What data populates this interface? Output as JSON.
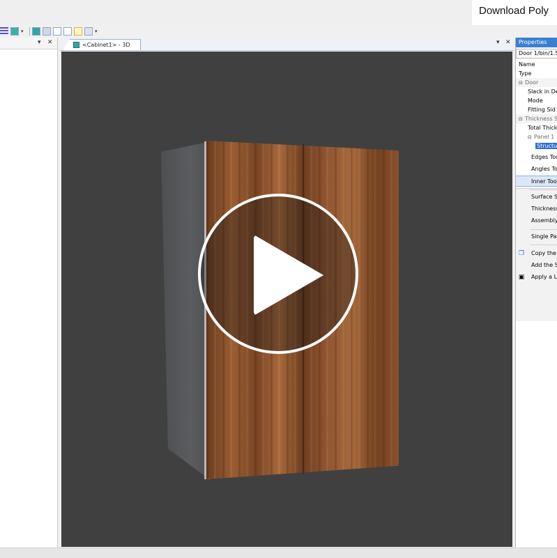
{
  "banner": {
    "text": "Download Poly"
  },
  "left_panel": {
    "pin": "▾",
    "close": "✕"
  },
  "document": {
    "tab_label": "<Cabinet1> - 3D",
    "pin": "▾",
    "close": "✕"
  },
  "properties": {
    "title": "Properties",
    "selector": "Door 1/bin/1.5",
    "rows": [
      {
        "label": "Name",
        "kind": "prop"
      },
      {
        "label": "Type",
        "kind": "prop"
      },
      {
        "label": "Door",
        "kind": "cat"
      },
      {
        "label": "Slack in De",
        "kind": "prop"
      },
      {
        "label": "Mode",
        "kind": "prop"
      },
      {
        "label": "Fitting Sid",
        "kind": "prop"
      },
      {
        "label": "Thickness S",
        "kind": "cat"
      },
      {
        "label": "Total Thick",
        "kind": "prop"
      },
      {
        "label": "Panel 1",
        "kind": "sub"
      },
      {
        "label": "Structu",
        "kind": "sel"
      }
    ],
    "menu": {
      "items": [
        {
          "label": "Edges Too",
          "icon": ""
        },
        {
          "label": "Angles To",
          "icon": ""
        },
        {
          "label": "Inner Too",
          "icon": ""
        },
        {
          "label": "Surface S",
          "icon": ""
        },
        {
          "label": "Thickness",
          "icon": ""
        },
        {
          "label": "Assembly",
          "icon": ""
        },
        {
          "label": "Single Pa",
          "icon": ""
        },
        {
          "label": "Copy the",
          "icon": "copy-icon"
        },
        {
          "label": "Add the S",
          "icon": ""
        },
        {
          "label": "Apply a L",
          "icon": "save-icon"
        }
      ],
      "highlighted": "Inner Too"
    }
  },
  "colors": {
    "viewport": "#404040",
    "accent": "#3a7fd0",
    "door_wood": "#8f5430"
  }
}
